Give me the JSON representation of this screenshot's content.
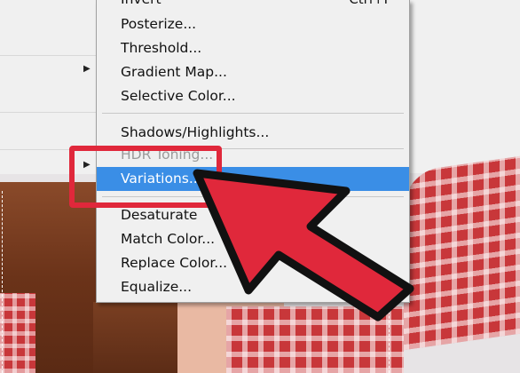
{
  "menu": {
    "items": [
      {
        "label": "Invert",
        "shortcut": "Ctrl+I",
        "state": "normal"
      },
      {
        "label": "Posterize...",
        "shortcut": "",
        "state": "normal"
      },
      {
        "label": "Threshold...",
        "shortcut": "",
        "state": "normal"
      },
      {
        "label": "Gradient Map...",
        "shortcut": "",
        "state": "normal"
      },
      {
        "label": "Selective Color...",
        "shortcut": "",
        "state": "normal"
      },
      {
        "label": "Shadows/Highlights...",
        "shortcut": "",
        "state": "normal"
      },
      {
        "label": "HDR Toning...",
        "shortcut": "",
        "state": "disabled"
      },
      {
        "label": "Variations...",
        "shortcut": "",
        "state": "highlighted"
      },
      {
        "label": "Desaturate",
        "shortcut": "",
        "state": "normal"
      },
      {
        "label": "Match Color...",
        "shortcut": "",
        "state": "normal"
      },
      {
        "label": "Replace Color...",
        "shortcut": "",
        "state": "normal"
      },
      {
        "label": "Equalize...",
        "shortcut": "",
        "state": "normal"
      }
    ]
  },
  "parent_menu": {
    "arrow_glyph": "▶"
  },
  "annotation": {
    "box_color": "#e0283b",
    "arrow_color": "#e0283b",
    "arrow_outline": "#111111"
  },
  "colors": {
    "highlight": "#3a8ee6",
    "menu_bg": "#f0f0f0"
  }
}
